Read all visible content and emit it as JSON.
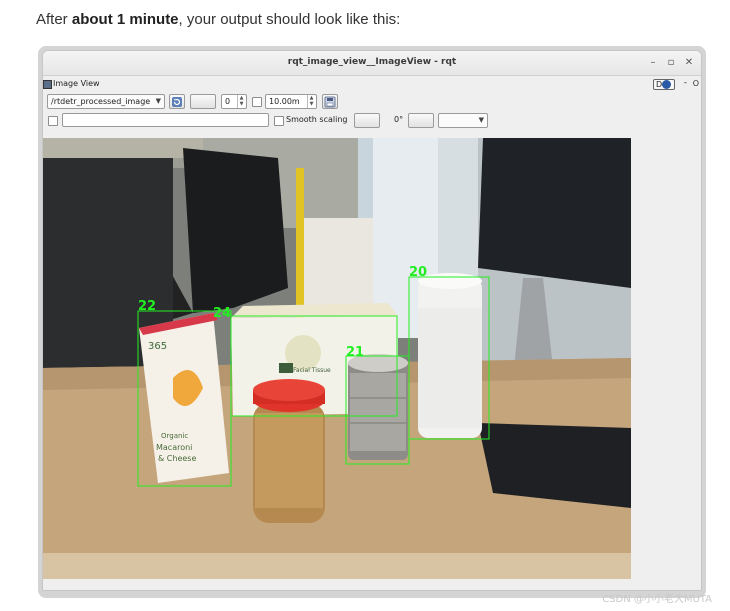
{
  "intro": {
    "prefix": "After ",
    "bold": "about 1 minute",
    "suffix": ", your output should look like this:"
  },
  "window": {
    "title": "rqt_image_view__ImageView - rqt",
    "controls": [
      "–",
      "▫",
      "✕"
    ]
  },
  "panel": {
    "title": "Image View",
    "help_badge": "D",
    "dash": "-",
    "o": "O"
  },
  "toolbar": {
    "topic_value": "/rtdetr_processed_image",
    "spin_value": "0",
    "time_value": "10.00m",
    "smooth_label": "Smooth scaling",
    "rotation_label": "0°"
  },
  "detections": [
    {
      "id": "22",
      "label": "22",
      "color": "#22ee22"
    },
    {
      "id": "24",
      "label": "24",
      "color": "#22ee22"
    },
    {
      "id": "21",
      "label": "21",
      "color": "#22ee22"
    },
    {
      "id": "20",
      "label": "20",
      "color": "#22ee22"
    }
  ],
  "objects": {
    "box_brand": "365",
    "box_line1": "Organic",
    "box_line2": "Macaroni",
    "box_line3": "& Cheese",
    "tissue_brand": "365",
    "tissue_text": "Facial Tissue"
  },
  "watermark": "CSDN @小小老大MUTA",
  "colors": {
    "detection": "#22ee22",
    "window_bg": "#efefef"
  }
}
